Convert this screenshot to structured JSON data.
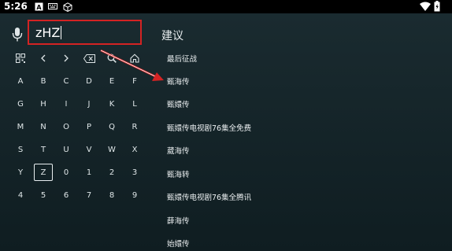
{
  "status_bar": {
    "time": "5:26",
    "icons": [
      "a-box-icon",
      "keyboard-icon",
      "cube-icon",
      "wifi-icon",
      "battery-icon"
    ]
  },
  "search": {
    "value": "zHZ"
  },
  "suggestions": {
    "title": "建议",
    "items": [
      "最后征战",
      "甄海传",
      "甄嬛传",
      "甄嬛传电视剧76集全免费",
      "葳海传",
      "甄海转",
      "甄嬛传电视剧76集全腾讯",
      "薛海传",
      "始嬛传"
    ]
  },
  "keyboard": {
    "tool_row": [
      "qr-code-icon",
      "left-arrow-icon",
      "right-arrow-icon",
      "backspace-icon",
      "search-icon",
      "home-icon"
    ],
    "rows": [
      [
        "A",
        "B",
        "C",
        "D",
        "E",
        "F"
      ],
      [
        "G",
        "H",
        "I",
        "J",
        "K",
        "L"
      ],
      [
        "M",
        "N",
        "O",
        "P",
        "Q",
        "R"
      ],
      [
        "S",
        "T",
        "U",
        "V",
        "W",
        "X"
      ],
      [
        "Y",
        "Z",
        "0",
        "1",
        "2",
        "3"
      ],
      [
        "4",
        "5",
        "6",
        "7",
        "8",
        "9"
      ]
    ],
    "focused_key": "Z"
  },
  "colors": {
    "highlight_border": "#d42323",
    "annotation_arrow": "#d42323",
    "background": "#132226"
  }
}
